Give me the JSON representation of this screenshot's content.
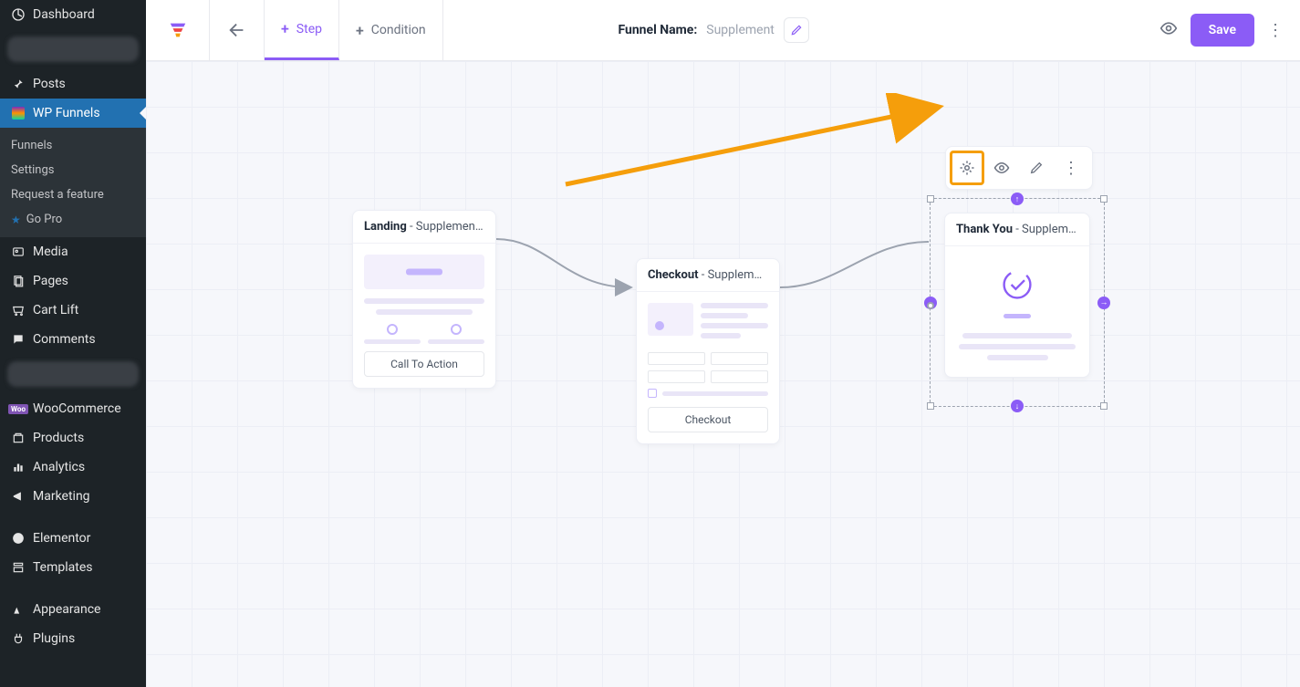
{
  "sidebar": {
    "items": [
      {
        "label": "Dashboard",
        "icon": "dashboard-icon"
      },
      {
        "label": "Posts",
        "icon": "pin-icon"
      },
      {
        "label": "WP Funnels",
        "icon": "wp-funnels-icon",
        "active": true
      },
      {
        "label": "Media",
        "icon": "media-icon"
      },
      {
        "label": "Pages",
        "icon": "pages-icon"
      },
      {
        "label": "Cart Lift",
        "icon": "cart-lift-icon"
      },
      {
        "label": "Comments",
        "icon": "comments-icon"
      },
      {
        "label": "WooCommerce",
        "icon": "woo-icon"
      },
      {
        "label": "Products",
        "icon": "products-icon"
      },
      {
        "label": "Analytics",
        "icon": "analytics-icon"
      },
      {
        "label": "Marketing",
        "icon": "marketing-icon"
      },
      {
        "label": "Elementor",
        "icon": "elementor-icon"
      },
      {
        "label": "Templates",
        "icon": "templates-icon"
      },
      {
        "label": "Appearance",
        "icon": "appearance-icon"
      },
      {
        "label": "Plugins",
        "icon": "plugins-icon"
      }
    ],
    "submenu": {
      "funnels": "Funnels",
      "settings": "Settings",
      "request": "Request a feature",
      "go_pro": "Go Pro"
    }
  },
  "topbar": {
    "step": "Step",
    "condition": "Condition",
    "funnel_name_label": "Funnel Name:",
    "funnel_name_value": "Supplement",
    "save": "Save"
  },
  "cards": {
    "landing": {
      "title": "Landing",
      "sub": " - Supplement La…",
      "cta": "Call To Action"
    },
    "checkout": {
      "title": "Checkout",
      "sub": " - Supplement C…",
      "cta": "Checkout"
    },
    "thankyou": {
      "title": "Thank You",
      "sub": " - Supplement T…"
    }
  }
}
